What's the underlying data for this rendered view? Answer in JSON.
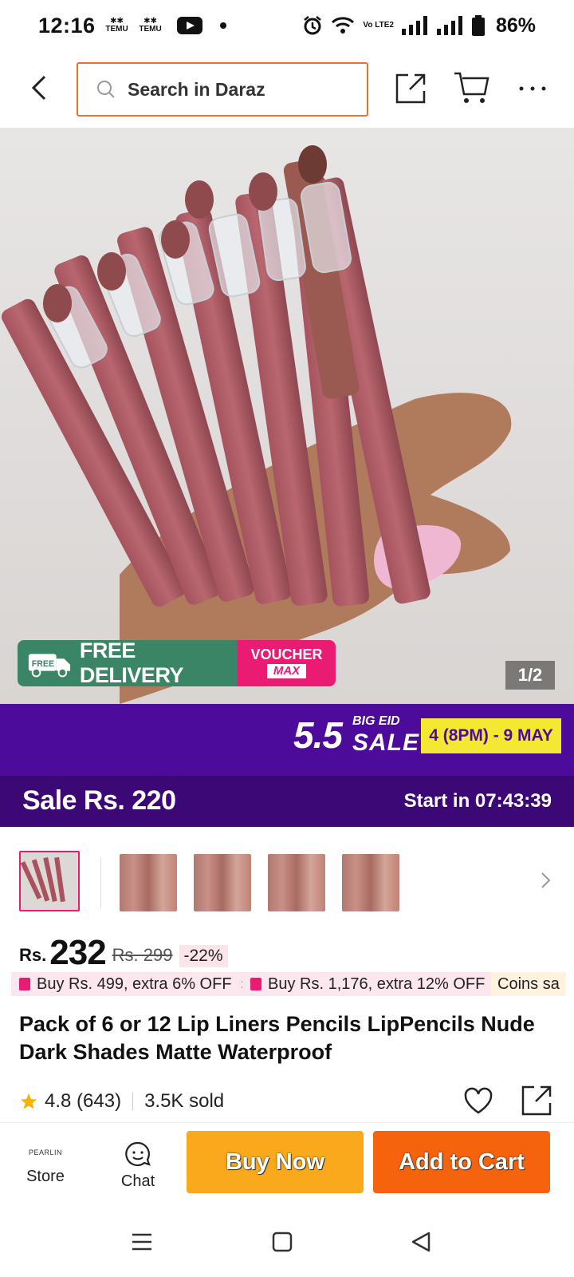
{
  "status_bar": {
    "time": "12:16",
    "temu_1": "TEMU",
    "temu_2": "TEMU",
    "network_label": "Vo LTE2",
    "battery": "86%"
  },
  "top_nav": {
    "search_placeholder": "Search in Daraz"
  },
  "hero": {
    "free_delivery": "FREE DELIVERY",
    "free_badge": "FREE",
    "voucher_top": "VOUCHER",
    "voucher_bottom": "MAX",
    "image_counter": "1/2"
  },
  "campaign": {
    "event_number": "5.5",
    "big_eid": "BIG EID",
    "sale": "SALE",
    "dates": "4 (8PM) - 9 MAY"
  },
  "sale_bar": {
    "price_text": "Sale Rs. 220",
    "countdown": "Start in 07:43:39"
  },
  "thumbnails": {
    "count": 5,
    "active_index": 0
  },
  "pricing": {
    "currency": "Rs.",
    "price": "232",
    "original_price": "Rs. 299",
    "discount": "-22%"
  },
  "promos": [
    {
      "label": "Buy Rs. 499, extra 6% OFF"
    },
    {
      "label": "Buy Rs. 1,176, extra 12% OFF"
    },
    {
      "label": "Coins sa"
    }
  ],
  "product": {
    "title": "Pack of 6 or 12 Lip Liners Pencils LipPencils Nude Dark Shades Matte Waterproof",
    "rating": "4.8 (643)",
    "sold": "3.5K sold"
  },
  "action_bar": {
    "store_logo_text": "PEARLIN",
    "store_label": "Store",
    "chat_label": "Chat",
    "buy_now": "Buy Now",
    "add_to_cart": "Add to Cart"
  },
  "colors": {
    "brand_orange": "#f5630d",
    "buy_now_yellow": "#f9a91b",
    "campaign_purple": "#4c0b9a",
    "sale_bar_purple": "#3c0876",
    "accent_pink": "#ea1b73",
    "delivery_green": "#3a8566"
  }
}
